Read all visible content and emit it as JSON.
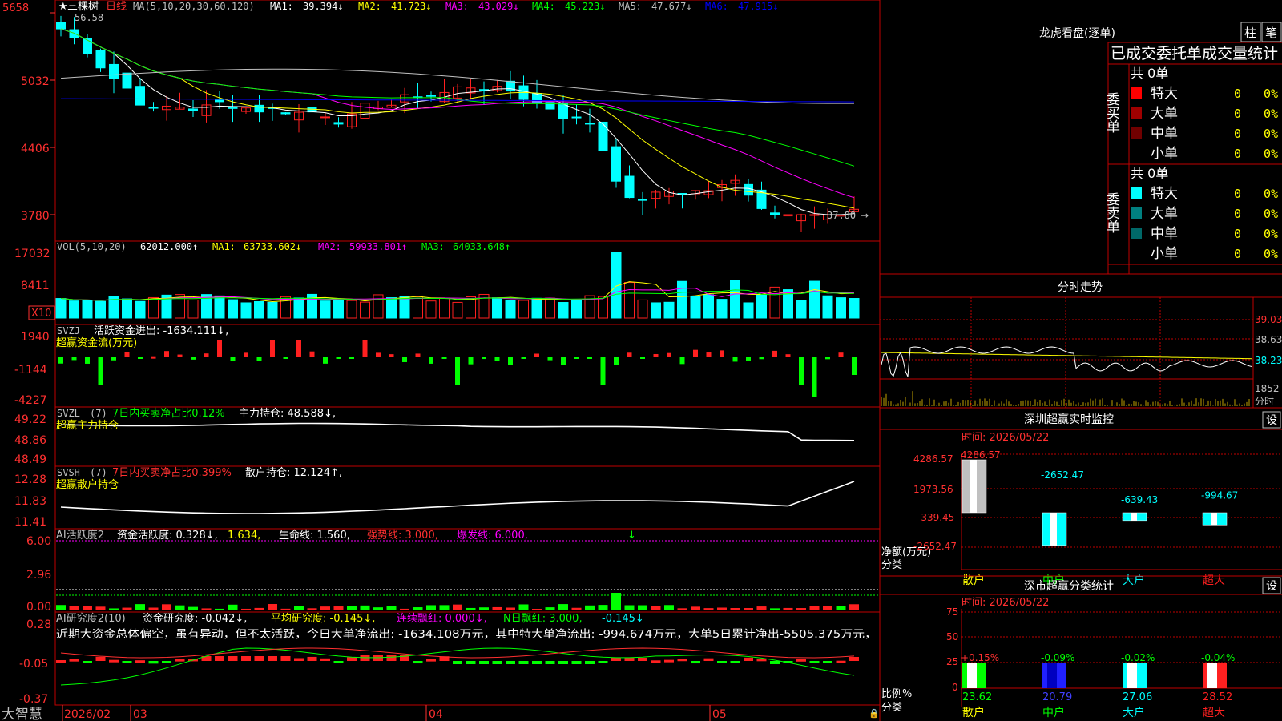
{
  "colors": {
    "up": "#ff2020",
    "down": "#00ffff",
    "ma1": "#ffffff",
    "ma2": "#ffff00",
    "ma3": "#ff00ff",
    "ma4": "#00ff00",
    "ma5": "#c0c0c0",
    "ma6": "#0000ff",
    "frame": "#c00000",
    "axis": "#ff3030"
  },
  "main": {
    "stock_name": "三棵树",
    "period": "日线",
    "ma_label": "MA(5,10,20,30,60,120)",
    "ma": [
      {
        "k": "MA1:",
        "v": "39.394↓"
      },
      {
        "k": "MA2:",
        "v": "41.723↓"
      },
      {
        "k": "MA3:",
        "v": "43.029↓"
      },
      {
        "k": "MA4:",
        "v": "45.223↓"
      },
      {
        "k": "MA5:",
        "v": "47.677↓"
      },
      {
        "k": "MA6:",
        "v": "47.915↓"
      }
    ],
    "y_ticks": [
      "5658",
      "5032",
      "4406",
      "3780"
    ],
    "high_mark": "56.58",
    "low_mark": "37.80"
  },
  "vol": {
    "label": "VOL(5,10,20)",
    "value": "62012.000↑",
    "ma": [
      {
        "k": "MA1:",
        "v": "63733.602↓"
      },
      {
        "k": "MA2:",
        "v": "59933.801↑"
      },
      {
        "k": "MA3:",
        "v": "64033.648↑"
      }
    ],
    "y_ticks": [
      "17032",
      "8411"
    ],
    "unit": "X10"
  },
  "svzj": {
    "label": "SVZJ",
    "line1": "活跃资金进出: -1634.111↓,",
    "line2": "超赢资金流(万元)",
    "y_ticks": [
      "1940",
      "-1144",
      "-4227"
    ]
  },
  "svzl": {
    "label": "SVZL",
    "arg": "(7)",
    "t1": "7日内买卖净占比0.12%",
    "t2": "主力持仓: 48.588↓,",
    "line2": "超赢主力持仓",
    "y_ticks": [
      "49.22",
      "48.86",
      "48.49"
    ]
  },
  "svsh": {
    "label": "SVSH",
    "arg": "(7)",
    "t1": "7日内买卖净占比0.399%",
    "t2": "散户持仓: 12.124↑,",
    "line2": "超赢散户持仓",
    "y_ticks": [
      "12.28",
      "11.83",
      "11.41"
    ]
  },
  "ai2": {
    "label": "AI活跃度2",
    "t1": "资金活跃度: 0.328↓,",
    "t2": "1.634,",
    "t3": "生命线: 1.560,",
    "t4": "强势线: 3.000,",
    "t5": "爆发线: 6.000,",
    "y_ticks": [
      "6.00",
      "2.96",
      "0.00"
    ]
  },
  "ai3": {
    "label": "AI研究度2(10)",
    "t1": "资金研究度: -0.042↓,",
    "t2": "平均研究度: -0.145↓,",
    "t3": "连续飘红: 0.000↓,",
    "t4": "N日飘红: 3.000,",
    "t5": "-0.145↓",
    "summary": "近期大资金总体偏空，虽有异动，但不太活跃，今日大单净流出: -1634.108万元，其中特大单净流出: -994.674万元，大单5日累计净出-5505.375万元，",
    "y_ticks": [
      "0.28",
      "-0.05",
      "-0.37"
    ]
  },
  "xaxis": {
    "brand": "大智慧",
    "labels": [
      "2026/02",
      "03",
      "04",
      "05"
    ]
  },
  "longhu": {
    "title": "龙虎看盘(逐单)",
    "btn1": "柱",
    "btn2": "笔",
    "header": "已成交委托单成交量统计",
    "buy_label": "委买单",
    "sell_label": "委卖单",
    "buy_total": "共 0单",
    "sell_total": "共 0单",
    "buy_rows": [
      {
        "name": "特大",
        "v": "0",
        "p": "0%",
        "c": "#ff0000"
      },
      {
        "name": "大单",
        "v": "0",
        "p": "0%",
        "c": "#a00000"
      },
      {
        "name": "中单",
        "v": "0",
        "p": "0%",
        "c": "#700000"
      },
      {
        "name": "小单",
        "v": "0",
        "p": "0%",
        "c": ""
      }
    ],
    "sell_rows": [
      {
        "name": "特大",
        "v": "0",
        "p": "0%",
        "c": "#00ffff"
      },
      {
        "name": "大单",
        "v": "0",
        "p": "0%",
        "c": "#008080"
      },
      {
        "name": "中单",
        "v": "0",
        "p": "0%",
        "c": "#006868"
      },
      {
        "name": "小单",
        "v": "0",
        "p": "0%",
        "c": ""
      }
    ]
  },
  "intraday": {
    "title": "分时走势",
    "y_ticks": [
      "39.03",
      "38.63",
      "38.23"
    ],
    "vol_tick": "1852",
    "unit": "分时"
  },
  "monitor": {
    "title": "深圳超赢实时监控",
    "btn": "设",
    "time": "时间: 2026/05/22",
    "y_ticks": [
      "4286.57",
      "1973.56",
      "-339.45",
      "-2652.47"
    ],
    "ylabel": "净额(万元)",
    "xlabel": "分类",
    "chart_data": {
      "type": "bar",
      "categories": [
        "散户",
        "中户",
        "大户",
        "超大"
      ],
      "values": [
        4286.57,
        -2652.47,
        -639.43,
        -994.67
      ],
      "ylim": [
        -2652.47,
        4286.57
      ]
    }
  },
  "classify": {
    "title": "深市超赢分类统计",
    "btn": "设",
    "time": "时间: 2026/05/22",
    "y_ticks": [
      "75",
      "50",
      "25",
      "0"
    ],
    "ylabel": "比例%",
    "xlabel": "分类",
    "chart_data": {
      "type": "bar",
      "categories": [
        "散户",
        "中户",
        "大户",
        "超大"
      ],
      "values": [
        23.62,
        20.79,
        27.06,
        28.52
      ],
      "changes": [
        "+0.15%",
        "-0.09%",
        "-0.02%",
        "-0.04%"
      ],
      "ylim": [
        0,
        75
      ]
    }
  }
}
